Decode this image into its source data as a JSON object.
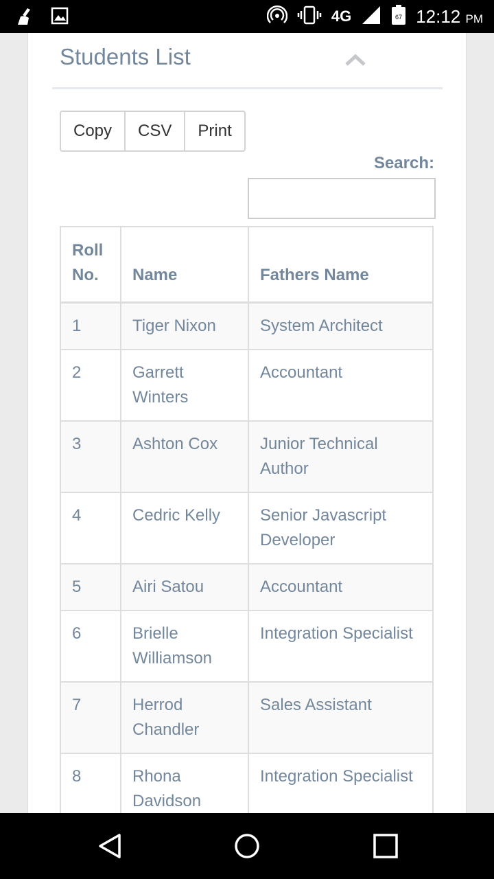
{
  "status_bar": {
    "network": "4G",
    "time": "12:12",
    "time_suffix": "PM",
    "battery_level": "67",
    "icons": [
      "broom-icon",
      "image-icon",
      "hotspot-icon",
      "vibrate-icon",
      "signal-icon",
      "battery-icon"
    ]
  },
  "panel": {
    "title": "Students List"
  },
  "toolbar": {
    "copy_label": "Copy",
    "csv_label": "CSV",
    "print_label": "Print"
  },
  "search": {
    "label": "Search:",
    "value": "",
    "placeholder": ""
  },
  "table": {
    "headers": [
      "Roll No.",
      "Name",
      "Fathers Name"
    ],
    "rows": [
      {
        "roll": "1",
        "name": "Tiger Nixon",
        "father": "System Architect"
      },
      {
        "roll": "2",
        "name": "Garrett Winters",
        "father": "Accountant"
      },
      {
        "roll": "3",
        "name": "Ashton Cox",
        "father": "Junior Technical Author"
      },
      {
        "roll": "4",
        "name": "Cedric Kelly",
        "father": "Senior Javascript Developer"
      },
      {
        "roll": "5",
        "name": "Airi Satou",
        "father": "Accountant"
      },
      {
        "roll": "6",
        "name": "Brielle Williamson",
        "father": "Integration Specialist"
      },
      {
        "roll": "7",
        "name": "Herrod Chandler",
        "father": "Sales Assistant"
      },
      {
        "roll": "8",
        "name": "Rhona Davidson",
        "father": "Integration Specialist"
      }
    ]
  },
  "nav_bar": {
    "icons": [
      "back-icon",
      "home-icon",
      "recents-icon"
    ]
  },
  "colors": {
    "text_muted": "#73879c",
    "border": "#dddddd",
    "stripe": "#f9f9f9",
    "background": "#ebebeb"
  }
}
